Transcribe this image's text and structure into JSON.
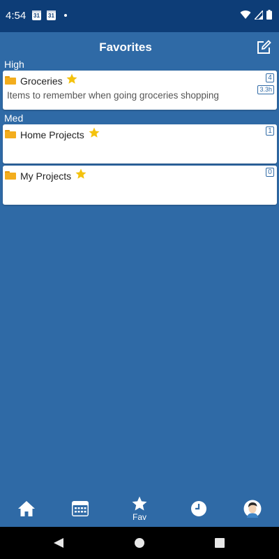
{
  "status_bar": {
    "time": "4:54",
    "calendar_day_1": "31",
    "calendar_day_2": "31"
  },
  "header": {
    "title": "Favorites"
  },
  "sections": [
    {
      "label": "High",
      "cards": [
        {
          "title": "Groceries",
          "count": "4",
          "time": "3.3h",
          "description": "Items to remember when going groceries shopping"
        }
      ]
    },
    {
      "label": "Med",
      "cards": [
        {
          "title": "Home Projects",
          "count": "1"
        },
        {
          "title": "My Projects",
          "count": "0"
        }
      ]
    }
  ],
  "bottom_nav": {
    "fav_label": "Fav"
  },
  "colors": {
    "primary": "#2f6aa6",
    "status_bar": "#0d3d77",
    "star": "#f4c20d",
    "folder": "#f3ad1d"
  }
}
